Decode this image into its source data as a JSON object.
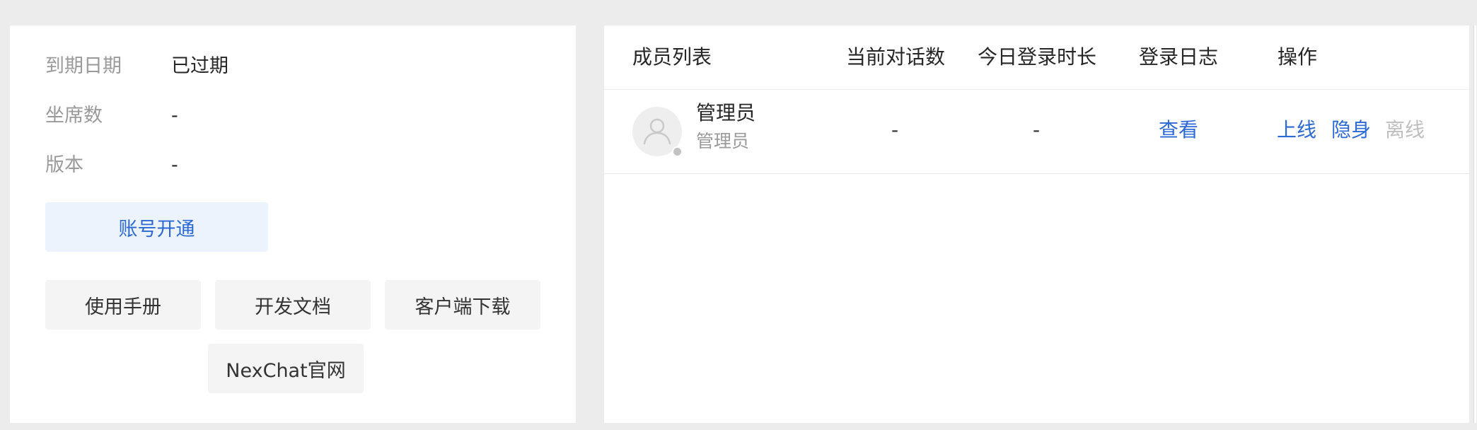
{
  "account_info": {
    "expiry_label": "到期日期",
    "expiry_value": "已过期",
    "seats_label": "坐席数",
    "seats_value": "-",
    "version_label": "版本",
    "version_value": "-"
  },
  "buttons": {
    "activate": "账号开通",
    "manual": "使用手册",
    "dev_docs": "开发文档",
    "client_download": "客户端下载",
    "website": "NexChat官网"
  },
  "member_table": {
    "headers": {
      "members": "成员列表",
      "current_conversations": "当前对话数",
      "today_login_duration": "今日登录时长",
      "login_log": "登录日志",
      "actions": "操作"
    },
    "rows": [
      {
        "name": "管理员",
        "role": "管理员",
        "status": "offline",
        "current_conversations": "-",
        "today_login_duration": "-",
        "login_log_link": "查看",
        "actions": {
          "online": "上线",
          "invisible": "隐身",
          "offline": "离线"
        }
      }
    ]
  },
  "colors": {
    "accent": "#2b6ad4",
    "accent_bg": "#ecf3fd",
    "background": "#ececec",
    "muted_text": "#9a9a9a",
    "disabled_text": "#bfbfbf",
    "offline_dot": "#c2c2c2"
  },
  "icons": {
    "avatar": "user-avatar-icon",
    "status": "status-dot-icon"
  }
}
